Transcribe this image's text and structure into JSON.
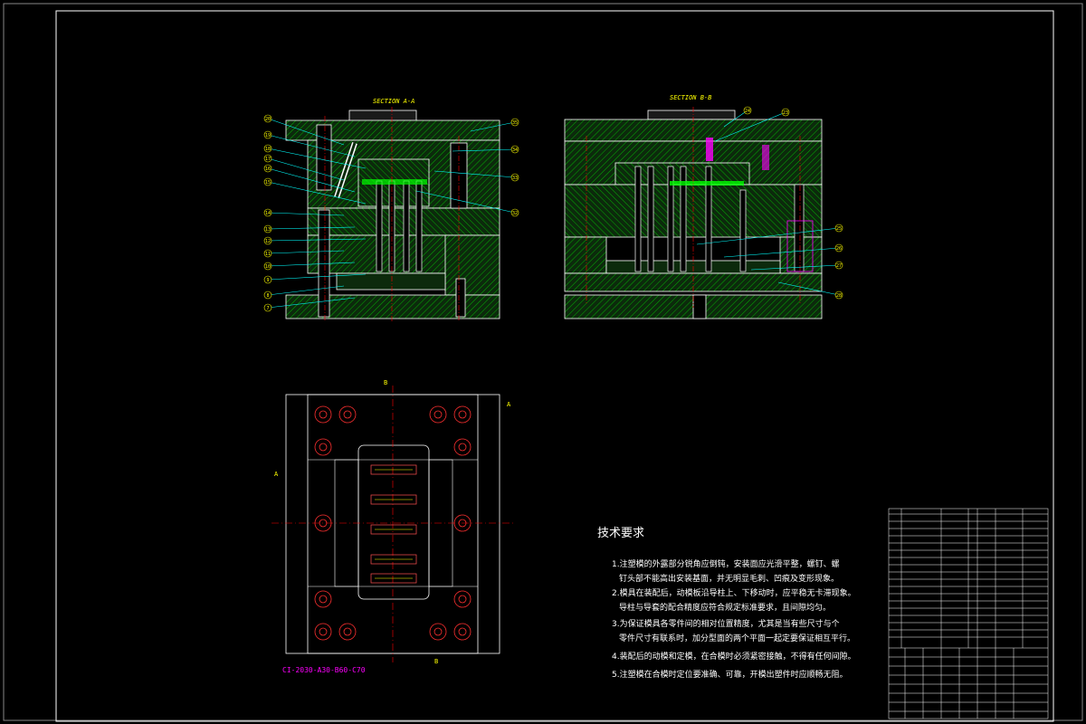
{
  "sections": {
    "a": "SECTION A-A",
    "b": "SECTION B-B"
  },
  "view_marks": {
    "a_top": "A",
    "a_left": "A",
    "b_top": "B",
    "b_bottom": "B"
  },
  "part_code": "CI-2030-A30-B60-C70",
  "tech_req": {
    "title": "技术要求",
    "lines": [
      "1.注塑模的外露部分锐角应倒钝，安装面应光滑平整，螺钉、螺",
      "钉头部不能高出安装基面，并无明显毛刺、凹痕及变形现象。",
      "2.模具在装配后，动模板沿导柱上、下移动时，应平稳无卡滞现象。",
      "导柱与导套的配合精度应符合规定标准要求，且间隙均匀。",
      "3.为保证模具各零件间的相对位置精度，尤其是当有些尺寸与个",
      "零件尺寸有联系时，加分型面的两个平面一起定要保证相互平行。",
      "4.装配后的动模和定模，在合模时必须紧密接触，不得有任何间隙。",
      "5.注塑模在合模时定位要准确、可靠，开模出塑件时应顺畅无阻。"
    ]
  },
  "callouts": {
    "left_a": [
      "20",
      "19",
      "18",
      "17",
      "16",
      "15",
      "14",
      "13",
      "12",
      "11",
      "10",
      "9",
      "8",
      "7"
    ],
    "right_a": [
      "35",
      "34",
      "33",
      "32"
    ],
    "top_b": [
      "24",
      "23"
    ],
    "right_b": [
      "25",
      "26",
      "27",
      "28"
    ]
  },
  "colors": {
    "background": "#000000",
    "hatch": "#00ff00",
    "fill": "#0c2a0c",
    "outline": "#ffffff",
    "center": "#ff0000",
    "text": "#ffff00",
    "highlight": "#ff00ff"
  }
}
